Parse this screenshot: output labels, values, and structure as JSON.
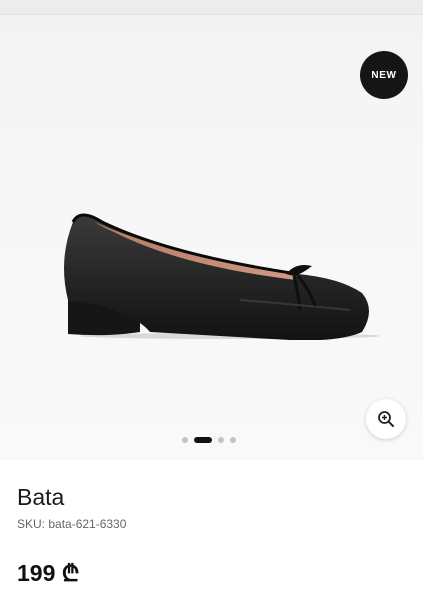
{
  "gallery": {
    "badge": "NEW",
    "image_icon": "ballet-flat-shoe-photo",
    "zoom_icon": "zoom-in-icon",
    "slides_total": 4,
    "active_slide": 2
  },
  "product": {
    "brand": "Bata",
    "sku": "SKU: bata-621-6330",
    "price": "199 ₾"
  },
  "colors": {
    "badge_bg": "#151515",
    "accent": "#111111"
  }
}
